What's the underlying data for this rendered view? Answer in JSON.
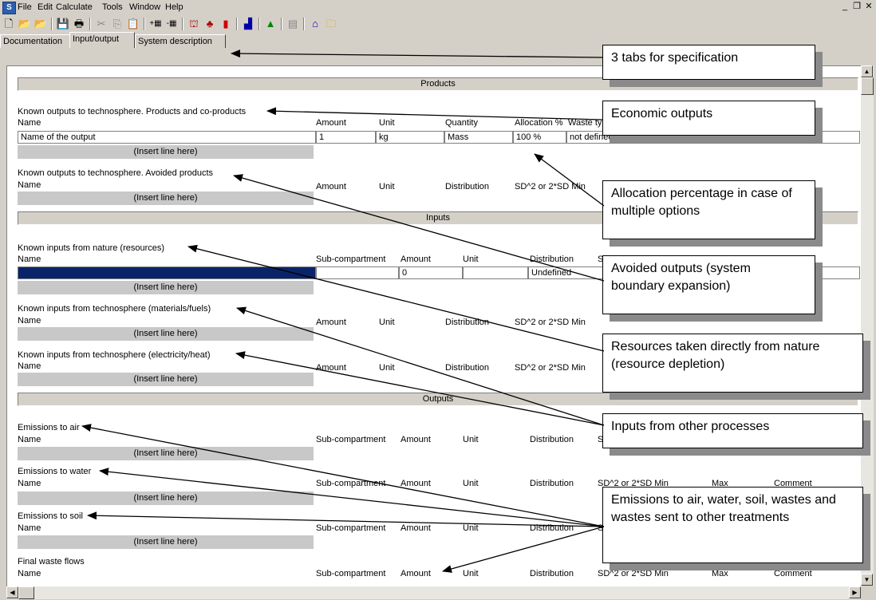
{
  "menu": [
    "File",
    "Edit",
    "Calculate",
    "Tools",
    "Window",
    "Help"
  ],
  "tabs": [
    "Documentation",
    "Input/output",
    "System description"
  ],
  "sections": {
    "products": "Products",
    "inputs": "Inputs",
    "outputs": "Outputs"
  },
  "insert_line": "(Insert line here)",
  "groups": {
    "known_outputs": "Known outputs to technosphere. Products and co-products",
    "avoided": "Known outputs to technosphere. Avoided products",
    "nature": "Known inputs from nature (resources)",
    "materials": "Known inputs from technosphere (materials/fuels)",
    "electricity": "Known inputs from technosphere (electricity/heat)",
    "air": "Emissions to air",
    "water": "Emissions to water",
    "soil": "Emissions to soil",
    "waste": "Final waste flows"
  },
  "columns": {
    "name": "Name",
    "amount": "Amount",
    "unit": "Unit",
    "quantity": "Quantity",
    "allocation": "Allocation %",
    "waste_type": "Waste ty",
    "distribution": "Distribution",
    "sd": "SD^2 or 2*SD",
    "min": "Min",
    "sd_min": "SD^2 or 2*SD Min",
    "sub_compartment": "Sub-compartment",
    "s_trunc": "S",
    "sd2_trunc": "SD^2 or 2*SD Min",
    "sd2_trunc2": "SD^2 or 2*SD Min",
    "max": "Max",
    "comment": "Comment"
  },
  "product_row": {
    "name": "Name of the output",
    "amount": "1",
    "unit": "kg",
    "quantity": "Mass",
    "allocation": "100 %",
    "waste_type": "not defined"
  },
  "resource_row": {
    "amount": "0",
    "distribution": "Undefined"
  },
  "callouts": {
    "tabs": "3 tabs for specification",
    "economic": "Economic outputs",
    "allocation": "Allocation percentage in case of multiple options",
    "avoided": "Avoided outputs (system boundary expansion)",
    "resources": "Resources taken directly from nature (resource depletion)",
    "inputs": "Inputs from other processes",
    "emissions": "Emissions to air, water, soil, wastes and wastes sent to other treatments"
  }
}
